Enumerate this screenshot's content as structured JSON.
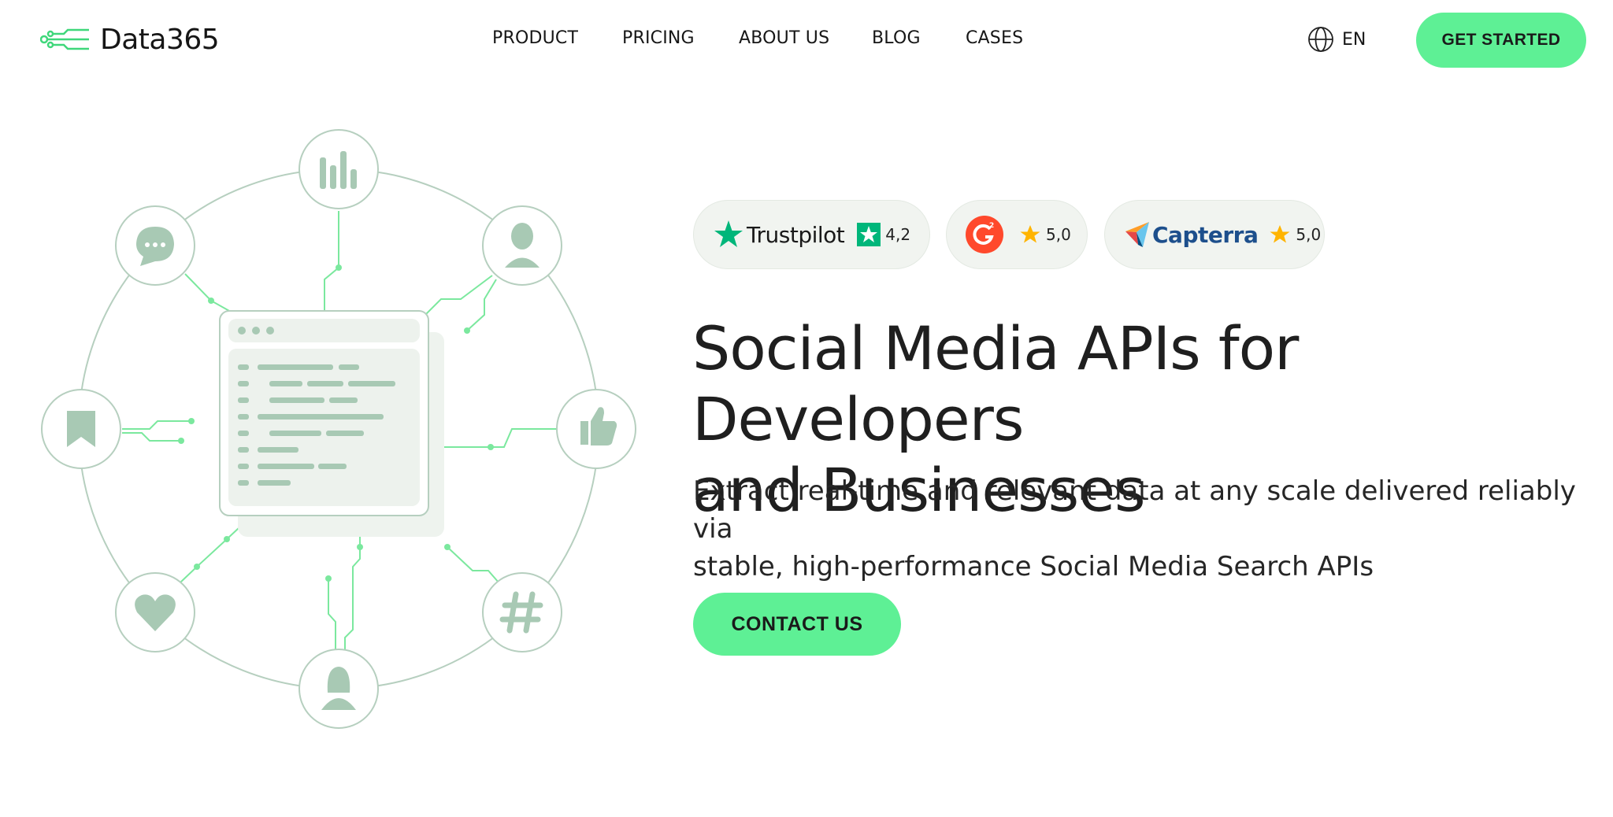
{
  "header": {
    "logo_text": "Data365",
    "nav": [
      {
        "label": "PRODUCT"
      },
      {
        "label": "PRICING"
      },
      {
        "label": "ABOUT US"
      },
      {
        "label": "BLOG"
      },
      {
        "label": "CASES"
      }
    ],
    "language": "EN",
    "cta_label": "GET STARTED"
  },
  "ratings": [
    {
      "name": "Trustpilot",
      "score": "4,2"
    },
    {
      "name": "G2",
      "score": "5,0"
    },
    {
      "name": "Capterra",
      "score": "5,0"
    }
  ],
  "hero": {
    "title_line1": "Social Media APIs for Developers",
    "title_line2": "and Businesses",
    "subtitle_line1": "Extract real-time and relevant data at any scale delivered reliably via",
    "subtitle_line2": "stable, high-performance Social Media Search APIs",
    "cta_label": "CONTACT US"
  },
  "illustration": {
    "icons": [
      "bar-chart-icon",
      "user-male-icon",
      "thumbs-up-icon",
      "hashtag-icon",
      "user-female-icon",
      "heart-icon",
      "bookmark-icon",
      "chat-bubble-icon"
    ]
  },
  "colors": {
    "accent": "#5ef095",
    "illustration_green": "#a8c9b4",
    "line_green": "#7be89e",
    "trustpilot_green": "#00b67a",
    "g2_red": "#ff492c",
    "capterra_blue": "#1d4f8c",
    "star_gold": "#ffb400"
  }
}
